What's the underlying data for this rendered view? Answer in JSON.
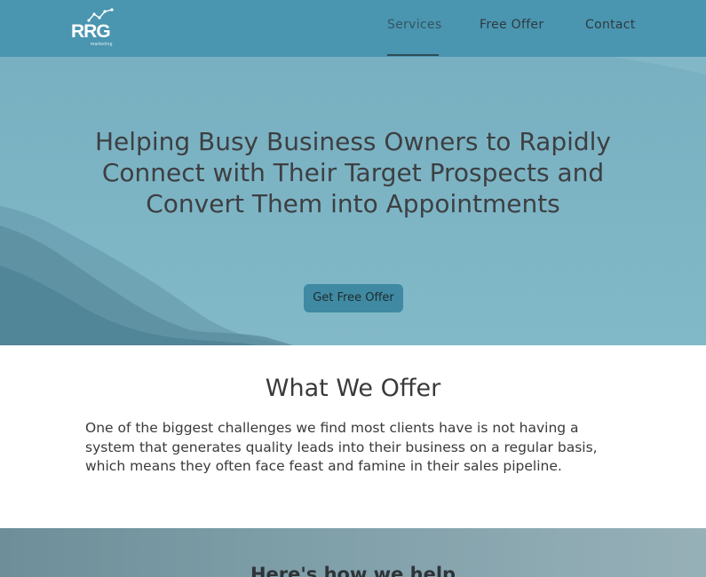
{
  "header": {
    "logo_text": "RRG",
    "logo_sub": "marketing",
    "nav": {
      "services": "Services",
      "free_offer": "Free Offer",
      "contact": "Contact"
    },
    "active_item": "Services"
  },
  "hero": {
    "title": "Helping Busy Business Owners to Rapidly Connect with Their Target Prospects and Convert Them into Appointments",
    "cta_label": "Get Free Offer"
  },
  "offer": {
    "heading": "What We Offer",
    "body": "One of the biggest challenges we find most clients have is not having a system that generates quality leads into their business on a regular basis, which means they often face feast and famine in their sales pipeline."
  },
  "help": {
    "heading": "Here's how we help"
  },
  "colors": {
    "header_bg": "#4a95b0",
    "hero_bg": "#7db5c5",
    "cta_bg": "#3f8aa2",
    "text": "#3a3a3a"
  },
  "icons": [
    "logo-chart-icon"
  ]
}
